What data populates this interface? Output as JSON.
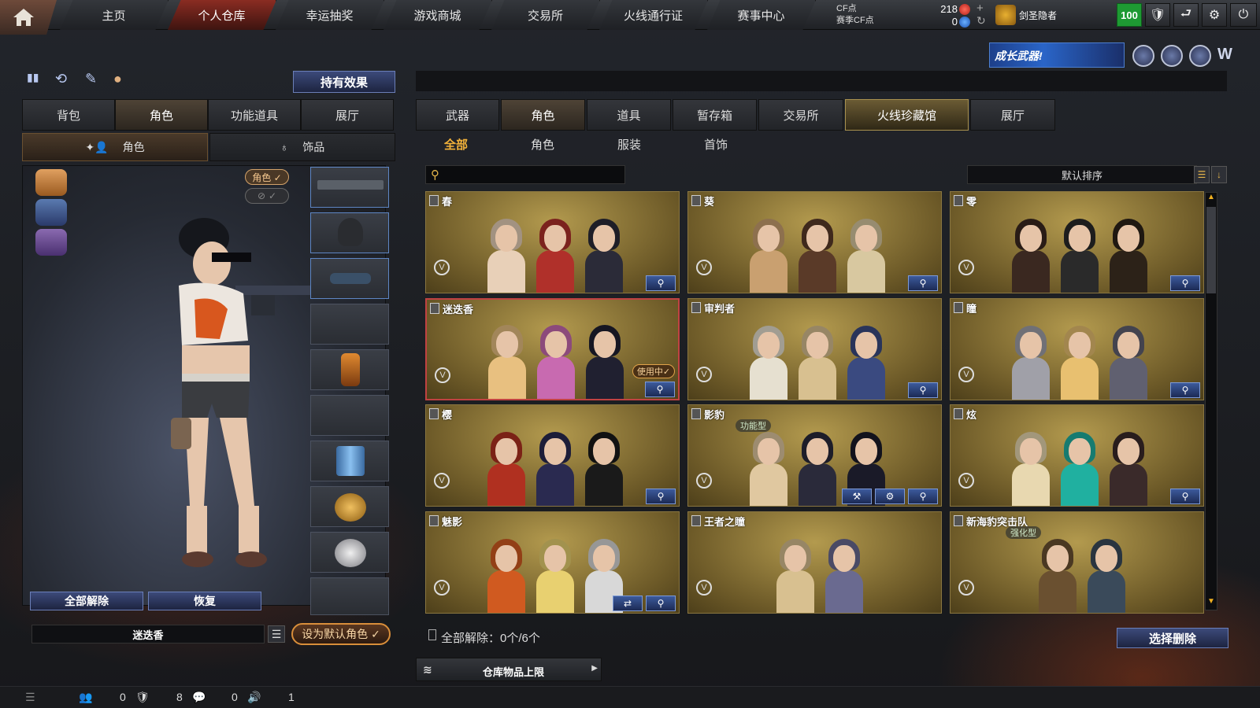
{
  "nav": {
    "tabs": [
      "主页",
      "个人仓库",
      "幸运抽奖",
      "游戏商城",
      "交易所",
      "火线通行证",
      "赛事中心"
    ],
    "active": 1
  },
  "currency": {
    "cf_label": "CF点",
    "season_cf_label": "赛季CF点",
    "cf_value": "218",
    "season_cf_value": "0"
  },
  "user": {
    "rank_name": "剑圣隐者",
    "vip_level": "100"
  },
  "banner": {
    "text": "成长武器!"
  },
  "left": {
    "effect_button": "持有效果",
    "tabs": [
      "背包",
      "角色",
      "功能道具",
      "展厅"
    ],
    "active_tab": 1,
    "subtabs": [
      "角色",
      "饰品"
    ],
    "role_toggle": "角色 ✓",
    "hide_toggle": "✓",
    "unequip_all": "全部解除",
    "restore": "恢复",
    "current_name": "迷迭香",
    "set_default": "设为默认角色 ✓"
  },
  "right": {
    "tabs": [
      "武器",
      "角色",
      "道具",
      "暂存箱",
      "交易所",
      "火线珍藏馆",
      "展厅"
    ],
    "active_tab": 1,
    "gold_tab": 5,
    "filters": [
      "全部",
      "角色",
      "服装",
      "首饰"
    ],
    "active_filter": 0,
    "search_placeholder": "",
    "sort_label": "默认排序",
    "cards": [
      {
        "name": "春",
        "colors": [
          "#e8d0b8",
          "#b0302a",
          "#2b2b38"
        ]
      },
      {
        "name": "葵",
        "colors": [
          "#c9a070",
          "#5a3a28",
          "#d8c8a0"
        ]
      },
      {
        "name": "零",
        "colors": [
          "#3a2820",
          "#2a2a2a",
          "#2c2218"
        ]
      },
      {
        "name": "迷迭香",
        "colors": [
          "#e8c080",
          "#c86ab0",
          "#202030"
        ],
        "in_use": "使用中✓"
      },
      {
        "name": "审判者",
        "colors": [
          "#e6e0d0",
          "#d8c090",
          "#3a4a80"
        ]
      },
      {
        "name": "瞳",
        "colors": [
          "#a0a0a8",
          "#e8c070",
          "#606070"
        ]
      },
      {
        "name": "樱",
        "colors": [
          "#b03020",
          "#2a2a50",
          "#1a1a1a"
        ]
      },
      {
        "name": "影豹",
        "colors": [
          "#e0c8a0",
          "#2a2a3a",
          "#1a1a28"
        ],
        "type": "功能型",
        "extra_icons": 2
      },
      {
        "name": "炫",
        "colors": [
          "#e8d8b0",
          "#20b0a0",
          "#3a2a2a"
        ]
      },
      {
        "name": "魅影",
        "colors": [
          "#d05a20",
          "#e8d070",
          "#d8d8d8"
        ],
        "extra_icons": 1
      },
      {
        "name": "王者之瞳",
        "colors": [
          "#d8c090",
          "#6a6a90"
        ]
      },
      {
        "name": "新海豹突击队",
        "colors": [
          "#6a5030",
          "#3a4a5a"
        ],
        "type": "强化型"
      }
    ],
    "unequip_status": "全部解除：0个/6个",
    "select_delete": "选择删除",
    "storage_limit": "仓库物品上限"
  },
  "status": {
    "friends": "0",
    "guild": "8",
    "chat": "0",
    "sound": "1"
  }
}
